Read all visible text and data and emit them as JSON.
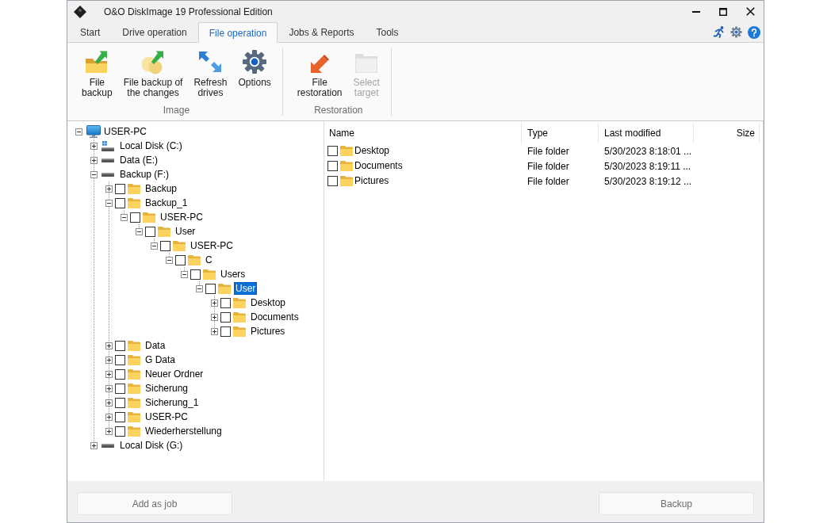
{
  "window": {
    "title": "O&O DiskImage 19 Professional Edition"
  },
  "tabs": [
    {
      "label": "Start",
      "selected": false
    },
    {
      "label": "Drive operation",
      "selected": false
    },
    {
      "label": "File operation",
      "selected": true
    },
    {
      "label": "Jobs & Reports",
      "selected": false
    },
    {
      "label": "Tools",
      "selected": false
    }
  ],
  "ribbon": {
    "groups": [
      {
        "label": "Image",
        "buttons": [
          {
            "label": "File\nbackup",
            "kind": "file-backup",
            "disabled": false
          },
          {
            "label": "File backup of\nthe changes",
            "kind": "changes-backup",
            "disabled": false
          },
          {
            "label": "Refresh\ndrives",
            "kind": "refresh",
            "disabled": false
          },
          {
            "label": "Options",
            "kind": "options",
            "disabled": false
          }
        ]
      },
      {
        "label": "Restoration",
        "buttons": [
          {
            "label": "File\nrestoration",
            "kind": "restore",
            "disabled": false
          },
          {
            "label": "Select\ntarget",
            "kind": "target",
            "disabled": true
          }
        ]
      }
    ]
  },
  "tree": [
    {
      "label": "USER-PC",
      "kind": "computer",
      "expanded": true,
      "selected": false,
      "children": [
        {
          "label": "Local Disk (C:)",
          "kind": "system-disk",
          "expanded": false,
          "selected": false
        },
        {
          "label": "Data (E:)",
          "kind": "disk",
          "expanded": false,
          "selected": false
        },
        {
          "label": "Backup (F:)",
          "kind": "disk",
          "expanded": true,
          "selected": false,
          "children": [
            {
              "label": "Backup",
              "kind": "folder",
              "checked": false,
              "expanded": false,
              "selected": false
            },
            {
              "label": "Backup_1",
              "kind": "folder",
              "checked": false,
              "expanded": true,
              "selected": false,
              "children": [
                {
                  "label": "USER-PC",
                  "kind": "folder",
                  "checked": false,
                  "expanded": true,
                  "selected": false,
                  "children": [
                    {
                      "label": "User",
                      "kind": "folder",
                      "checked": false,
                      "expanded": true,
                      "selected": false,
                      "children": [
                        {
                          "label": "USER-PC",
                          "kind": "folder",
                          "checked": false,
                          "expanded": true,
                          "selected": false,
                          "children": [
                            {
                              "label": "C",
                              "kind": "folder",
                              "checked": false,
                              "expanded": true,
                              "selected": false,
                              "children": [
                                {
                                  "label": "Users",
                                  "kind": "folder",
                                  "checked": false,
                                  "expanded": true,
                                  "selected": false,
                                  "children": [
                                    {
                                      "label": "User",
                                      "kind": "folder",
                                      "checked": false,
                                      "expanded": true,
                                      "selected": true,
                                      "children": [
                                        {
                                          "label": "Desktop",
                                          "kind": "folder",
                                          "checked": false,
                                          "expanded": false,
                                          "selected": false
                                        },
                                        {
                                          "label": "Documents",
                                          "kind": "folder",
                                          "checked": false,
                                          "expanded": false,
                                          "selected": false
                                        },
                                        {
                                          "label": "Pictures",
                                          "kind": "folder",
                                          "checked": false,
                                          "expanded": false,
                                          "selected": false
                                        }
                                      ]
                                    }
                                  ]
                                }
                              ]
                            }
                          ]
                        }
                      ]
                    }
                  ]
                }
              ]
            },
            {
              "label": "Data",
              "kind": "folder",
              "checked": false,
              "expanded": false,
              "selected": false
            },
            {
              "label": "G Data",
              "kind": "folder",
              "checked": false,
              "expanded": false,
              "selected": false
            },
            {
              "label": "Neuer Ordner",
              "kind": "folder",
              "checked": false,
              "expanded": false,
              "selected": false
            },
            {
              "label": "Sicherung",
              "kind": "folder",
              "checked": false,
              "expanded": false,
              "selected": false
            },
            {
              "label": "Sicherung_1",
              "kind": "folder",
              "checked": false,
              "expanded": false,
              "selected": false
            },
            {
              "label": "USER-PC",
              "kind": "folder",
              "checked": false,
              "expanded": false,
              "selected": false
            },
            {
              "label": "Wiederherstellung",
              "kind": "folder",
              "checked": false,
              "expanded": false,
              "selected": false
            }
          ]
        },
        {
          "label": "Local Disk (G:)",
          "kind": "disk",
          "expanded": false,
          "selected": false
        }
      ]
    }
  ],
  "file_list": {
    "columns": [
      "Name",
      "Type",
      "Last modified",
      "Size"
    ],
    "rows": [
      {
        "name": "Desktop",
        "type": "File folder",
        "modified": "5/30/2023 8:18:01 ...",
        "checked": false,
        "selected": false
      },
      {
        "name": "Documents",
        "type": "File folder",
        "modified": "5/30/2023 8:19:11 ...",
        "checked": false,
        "selected": false
      },
      {
        "name": "Pictures",
        "type": "File folder",
        "modified": "5/30/2023 8:19:12 ...",
        "checked": false,
        "selected": false
      }
    ]
  },
  "footer": {
    "buttons": [
      {
        "label": "Add as job",
        "disabled": true
      },
      {
        "label": "Backup",
        "disabled": true
      }
    ]
  }
}
